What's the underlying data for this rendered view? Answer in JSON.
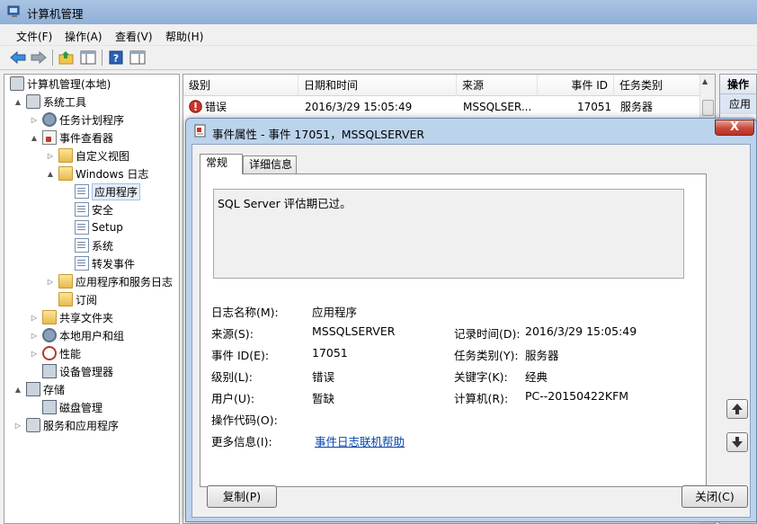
{
  "window": {
    "title": "计算机管理"
  },
  "menubar": [
    "文件(F)",
    "操作(A)",
    "查看(V)",
    "帮助(H)"
  ],
  "toolbar": {
    "buttons": [
      "back-icon",
      "forward-icon",
      "up-folder-icon",
      "show-tree-icon",
      "help-icon",
      "show-action-pane-icon"
    ]
  },
  "tree": [
    {
      "label": "计算机管理(本地)",
      "icon": "computer-management-icon",
      "expander": ""
    },
    {
      "label": "系统工具",
      "icon": "system-tools-icon",
      "expander": "▲"
    },
    {
      "label": "任务计划程序",
      "icon": "task-scheduler-icon",
      "expander": "▷"
    },
    {
      "label": "事件查看器",
      "icon": "event-viewer-icon",
      "expander": "▲"
    },
    {
      "label": "自定义视图",
      "icon": "folder-icon",
      "expander": "▷"
    },
    {
      "label": "Windows 日志",
      "icon": "folder-icon",
      "expander": "▲"
    },
    {
      "label": "应用程序",
      "icon": "log-icon",
      "expander": "",
      "selected": true
    },
    {
      "label": "安全",
      "icon": "log-icon",
      "expander": ""
    },
    {
      "label": "Setup",
      "icon": "log-icon",
      "expander": ""
    },
    {
      "label": "系统",
      "icon": "log-icon",
      "expander": ""
    },
    {
      "label": "转发事件",
      "icon": "log-icon",
      "expander": ""
    },
    {
      "label": "应用程序和服务日志",
      "icon": "folder-icon",
      "expander": "▷"
    },
    {
      "label": "订阅",
      "icon": "subscription-icon",
      "expander": ""
    },
    {
      "label": "共享文件夹",
      "icon": "shared-folders-icon",
      "expander": "▷"
    },
    {
      "label": "本地用户和组",
      "icon": "users-groups-icon",
      "expander": "▷"
    },
    {
      "label": "性能",
      "icon": "performance-icon",
      "expander": "▷"
    },
    {
      "label": "设备管理器",
      "icon": "device-manager-icon",
      "expander": ""
    },
    {
      "label": "存储",
      "icon": "storage-icon",
      "expander": "▲"
    },
    {
      "label": "磁盘管理",
      "icon": "disk-management-icon",
      "expander": ""
    },
    {
      "label": "服务和应用程序",
      "icon": "services-apps-icon",
      "expander": "▷"
    }
  ],
  "list": {
    "headers": [
      "级别",
      "日期和时间",
      "来源",
      "事件 ID",
      "任务类别"
    ],
    "rows": [
      {
        "level": "错误",
        "datetime": "2016/3/29 15:05:49",
        "source": "MSSQLSER...",
        "event_id": "17051",
        "task": "服务器"
      }
    ]
  },
  "actions": {
    "header": "操作",
    "item": "应用"
  },
  "dialog": {
    "title": "事件属性 - 事件 17051，MSSQLSERVER",
    "close": "X",
    "tabs": [
      "常规",
      "详细信息"
    ],
    "description": "SQL Server 评估期已过。",
    "fields": {
      "log_name_label": "日志名称(M):",
      "log_name": "应用程序",
      "source_label": "来源(S):",
      "source": "MSSQLSERVER",
      "logged_label": "记录时间(D):",
      "logged": "2016/3/29 15:05:49",
      "event_id_label": "事件 ID(E):",
      "event_id": "17051",
      "task_label": "任务类别(Y):",
      "task": "服务器",
      "level_label": "级别(L):",
      "level": "错误",
      "keywords_label": "关键字(K):",
      "keywords": "经典",
      "user_label": "用户(U):",
      "user": "暂缺",
      "computer_label": "计算机(R):",
      "computer": "PC--20150422KFM",
      "opcode_label": "操作代码(O):",
      "more_info_label": "更多信息(I):",
      "more_info_link": "事件日志联机帮助"
    },
    "copy_button": "复制(P)",
    "close_button": "关闭(C)"
  },
  "colors": {
    "error_red": "#c8332a",
    "link_blue": "#0645ad",
    "title_bar": "#a9c3e3"
  }
}
